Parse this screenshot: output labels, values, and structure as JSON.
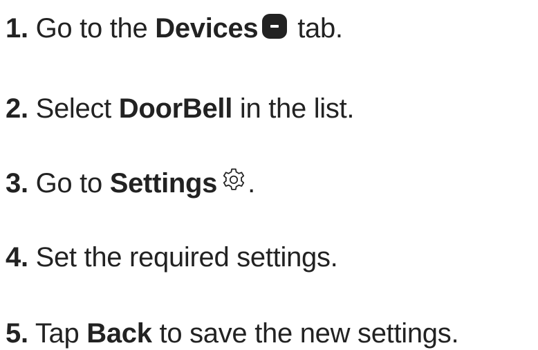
{
  "steps": [
    {
      "number": "1.",
      "text_before": " Go to the ",
      "bold": "Devices",
      "icon": "devices-tab-icon",
      "text_after": " tab."
    },
    {
      "number": "2.",
      "text_before": " Select ",
      "bold": "DoorBell",
      "text_after": " in the list."
    },
    {
      "number": "3.",
      "text_before": " Go to ",
      "bold": "Settings",
      "icon": "gear-icon",
      "text_after": "."
    },
    {
      "number": "4.",
      "text_before": " Set the required settings."
    },
    {
      "number": "5.",
      "text_before": " Tap ",
      "bold": "Back",
      "text_after": " to save the new settings."
    }
  ],
  "colors": {
    "text": "#222222",
    "icon": "#222222",
    "background": "#ffffff"
  }
}
